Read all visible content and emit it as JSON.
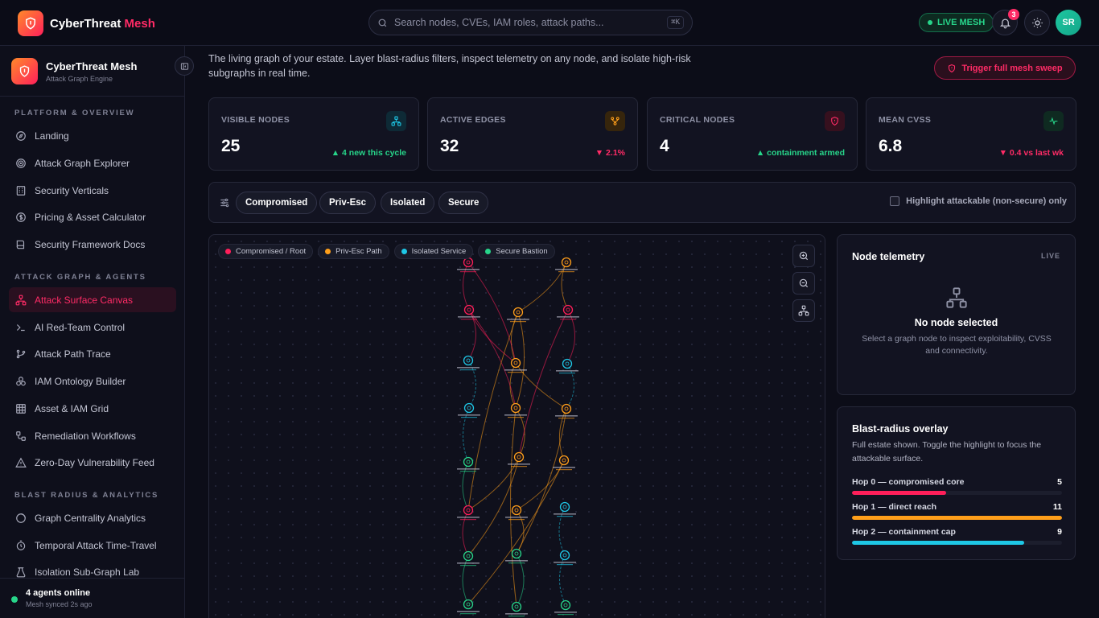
{
  "app": {
    "name": "CyberThreat",
    "name_accent": "Mesh"
  },
  "search": {
    "placeholder": "Search nodes, CVEs, IAM roles, attack paths...",
    "shortcut": "⌘K"
  },
  "header": {
    "live_label": "LIVE MESH",
    "notifications": "3",
    "avatar_initials": "SR"
  },
  "sidebar": {
    "title": "CyberThreat Mesh",
    "subtitle": "Attack Graph Engine",
    "sections": [
      {
        "label": "PLATFORM & OVERVIEW",
        "items": [
          "Landing",
          "Attack Graph Explorer",
          "Security Verticals",
          "Pricing & Asset Calculator",
          "Security Framework Docs"
        ]
      },
      {
        "label": "ATTACK GRAPH & AGENTS",
        "items": [
          "Attack Surface Canvas",
          "AI Red-Team Control",
          "Attack Path Trace",
          "IAM Ontology Builder",
          "Asset & IAM Grid",
          "Remediation Workflows",
          "Zero-Day Vulnerability Feed"
        ]
      },
      {
        "label": "BLAST RADIUS & ANALYTICS",
        "items": [
          "Graph Centrality Analytics",
          "Temporal Attack Time-Travel",
          "Isolation Sub-Graph Lab"
        ]
      }
    ],
    "active_item": "Attack Surface Canvas",
    "footer": {
      "title": "4 agents online",
      "subtitle": "Mesh synced 2s ago"
    }
  },
  "intro": "The living graph of your estate. Layer blast-radius filters, inspect telemetry on any node, and isolate high-risk subgraphs in real time.",
  "sweep_button": "Trigger full mesh sweep",
  "stats": [
    {
      "label": "VISIBLE NODES",
      "value": "25",
      "delta": "▲ 4 new this cycle",
      "trend": "up",
      "icon": "network-icon",
      "color": "#1ec7e6"
    },
    {
      "label": "ACTIVE EDGES",
      "value": "32",
      "delta": "▼ 2.1%",
      "trend": "down",
      "icon": "branch-icon",
      "color": "#ff9f1a"
    },
    {
      "label": "CRITICAL NODES",
      "value": "4",
      "delta": "▲ containment armed",
      "trend": "up",
      "icon": "shield-icon",
      "color": "#ff2b66"
    },
    {
      "label": "MEAN CVSS",
      "value": "6.8",
      "delta": "▼ 0.4 vs last wk",
      "trend": "down",
      "icon": "pulse-icon",
      "color": "#27d58a"
    }
  ],
  "filters": {
    "chips": [
      "Compromised",
      "Priv-Esc",
      "Isolated",
      "Secure"
    ],
    "checkbox_label": "Highlight attackable (non-secure) only",
    "checked": false
  },
  "legend": [
    {
      "label": "Compromised / Root",
      "color": "#ff1f5a"
    },
    {
      "label": "Priv-Esc Path",
      "color": "#ff9f1a"
    },
    {
      "label": "Isolated Service",
      "color": "#1ec7e6"
    },
    {
      "label": "Secure Bastion",
      "color": "#27d58a"
    }
  ],
  "telemetry": {
    "title": "Node telemetry",
    "tag": "LIVE",
    "empty_title": "No node selected",
    "empty_text": "Select a graph node to inspect exploitability, CVSS and connectivity."
  },
  "blast": {
    "title": "Blast-radius overlay",
    "description": "Full estate shown. Toggle the highlight to focus the attackable surface.",
    "hops": [
      {
        "label": "Hop 0 — compromised core",
        "value": "5",
        "fill": 0.45,
        "color": "#ff1f5a"
      },
      {
        "label": "Hop 1 — direct reach",
        "value": "11",
        "fill": 1.0,
        "color": "#ff9f1a"
      },
      {
        "label": "Hop 2 — containment cap",
        "value": "9",
        "fill": 0.82,
        "color": "#1ec7e6"
      }
    ]
  }
}
